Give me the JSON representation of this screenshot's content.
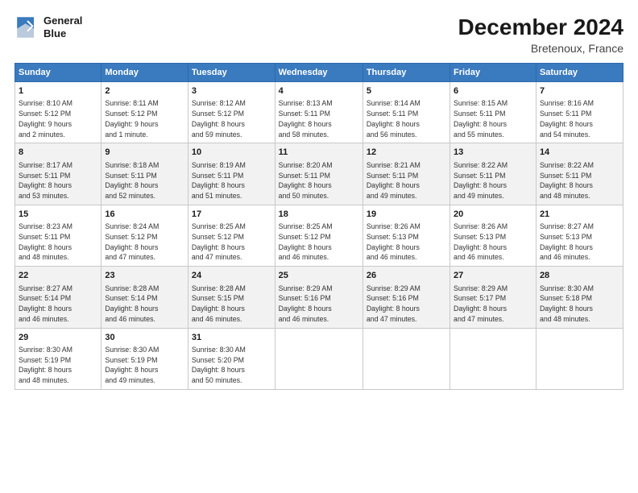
{
  "header": {
    "logo_line1": "General",
    "logo_line2": "Blue",
    "month": "December 2024",
    "location": "Bretenoux, France"
  },
  "weekdays": [
    "Sunday",
    "Monday",
    "Tuesday",
    "Wednesday",
    "Thursday",
    "Friday",
    "Saturday"
  ],
  "weeks": [
    [
      {
        "day": "1",
        "info": "Sunrise: 8:10 AM\nSunset: 5:12 PM\nDaylight: 9 hours\nand 2 minutes."
      },
      {
        "day": "2",
        "info": "Sunrise: 8:11 AM\nSunset: 5:12 PM\nDaylight: 9 hours\nand 1 minute."
      },
      {
        "day": "3",
        "info": "Sunrise: 8:12 AM\nSunset: 5:12 PM\nDaylight: 8 hours\nand 59 minutes."
      },
      {
        "day": "4",
        "info": "Sunrise: 8:13 AM\nSunset: 5:11 PM\nDaylight: 8 hours\nand 58 minutes."
      },
      {
        "day": "5",
        "info": "Sunrise: 8:14 AM\nSunset: 5:11 PM\nDaylight: 8 hours\nand 56 minutes."
      },
      {
        "day": "6",
        "info": "Sunrise: 8:15 AM\nSunset: 5:11 PM\nDaylight: 8 hours\nand 55 minutes."
      },
      {
        "day": "7",
        "info": "Sunrise: 8:16 AM\nSunset: 5:11 PM\nDaylight: 8 hours\nand 54 minutes."
      }
    ],
    [
      {
        "day": "8",
        "info": "Sunrise: 8:17 AM\nSunset: 5:11 PM\nDaylight: 8 hours\nand 53 minutes."
      },
      {
        "day": "9",
        "info": "Sunrise: 8:18 AM\nSunset: 5:11 PM\nDaylight: 8 hours\nand 52 minutes."
      },
      {
        "day": "10",
        "info": "Sunrise: 8:19 AM\nSunset: 5:11 PM\nDaylight: 8 hours\nand 51 minutes."
      },
      {
        "day": "11",
        "info": "Sunrise: 8:20 AM\nSunset: 5:11 PM\nDaylight: 8 hours\nand 50 minutes."
      },
      {
        "day": "12",
        "info": "Sunrise: 8:21 AM\nSunset: 5:11 PM\nDaylight: 8 hours\nand 49 minutes."
      },
      {
        "day": "13",
        "info": "Sunrise: 8:22 AM\nSunset: 5:11 PM\nDaylight: 8 hours\nand 49 minutes."
      },
      {
        "day": "14",
        "info": "Sunrise: 8:22 AM\nSunset: 5:11 PM\nDaylight: 8 hours\nand 48 minutes."
      }
    ],
    [
      {
        "day": "15",
        "info": "Sunrise: 8:23 AM\nSunset: 5:11 PM\nDaylight: 8 hours\nand 48 minutes."
      },
      {
        "day": "16",
        "info": "Sunrise: 8:24 AM\nSunset: 5:12 PM\nDaylight: 8 hours\nand 47 minutes."
      },
      {
        "day": "17",
        "info": "Sunrise: 8:25 AM\nSunset: 5:12 PM\nDaylight: 8 hours\nand 47 minutes."
      },
      {
        "day": "18",
        "info": "Sunrise: 8:25 AM\nSunset: 5:12 PM\nDaylight: 8 hours\nand 46 minutes."
      },
      {
        "day": "19",
        "info": "Sunrise: 8:26 AM\nSunset: 5:13 PM\nDaylight: 8 hours\nand 46 minutes."
      },
      {
        "day": "20",
        "info": "Sunrise: 8:26 AM\nSunset: 5:13 PM\nDaylight: 8 hours\nand 46 minutes."
      },
      {
        "day": "21",
        "info": "Sunrise: 8:27 AM\nSunset: 5:13 PM\nDaylight: 8 hours\nand 46 minutes."
      }
    ],
    [
      {
        "day": "22",
        "info": "Sunrise: 8:27 AM\nSunset: 5:14 PM\nDaylight: 8 hours\nand 46 minutes."
      },
      {
        "day": "23",
        "info": "Sunrise: 8:28 AM\nSunset: 5:14 PM\nDaylight: 8 hours\nand 46 minutes."
      },
      {
        "day": "24",
        "info": "Sunrise: 8:28 AM\nSunset: 5:15 PM\nDaylight: 8 hours\nand 46 minutes."
      },
      {
        "day": "25",
        "info": "Sunrise: 8:29 AM\nSunset: 5:16 PM\nDaylight: 8 hours\nand 46 minutes."
      },
      {
        "day": "26",
        "info": "Sunrise: 8:29 AM\nSunset: 5:16 PM\nDaylight: 8 hours\nand 47 minutes."
      },
      {
        "day": "27",
        "info": "Sunrise: 8:29 AM\nSunset: 5:17 PM\nDaylight: 8 hours\nand 47 minutes."
      },
      {
        "day": "28",
        "info": "Sunrise: 8:30 AM\nSunset: 5:18 PM\nDaylight: 8 hours\nand 48 minutes."
      }
    ],
    [
      {
        "day": "29",
        "info": "Sunrise: 8:30 AM\nSunset: 5:19 PM\nDaylight: 8 hours\nand 48 minutes."
      },
      {
        "day": "30",
        "info": "Sunrise: 8:30 AM\nSunset: 5:19 PM\nDaylight: 8 hours\nand 49 minutes."
      },
      {
        "day": "31",
        "info": "Sunrise: 8:30 AM\nSunset: 5:20 PM\nDaylight: 8 hours\nand 50 minutes."
      },
      null,
      null,
      null,
      null
    ]
  ]
}
